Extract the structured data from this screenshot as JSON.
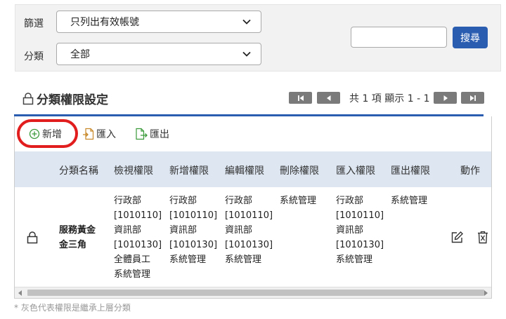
{
  "filters": {
    "screen_label": "篩選",
    "screen_value": "只列出有效帳號",
    "category_label": "分類",
    "category_value": "全部",
    "search_button": "搜尋"
  },
  "section": {
    "title": "分類權限設定",
    "pager_text": "共 1 項 顯示 1 - 1"
  },
  "toolbar": {
    "add_label": "新增",
    "import_label": "匯入",
    "export_label": "匯出"
  },
  "table": {
    "headers": [
      "分類名稱",
      "檢視權限",
      "新增權限",
      "編輯權限",
      "刪除權限",
      "匯入權限",
      "匯出權限",
      "動作"
    ],
    "rows": [
      {
        "name_line1": "服務黃金",
        "name_line2": "金三角",
        "view": [
          "行政部",
          "[1010110]",
          "資訊部",
          "[1010130]",
          "全體員工",
          "系統管理"
        ],
        "add": [
          "行政部",
          "[1010110]",
          "資訊部",
          "[1010130]",
          "系統管理"
        ],
        "edit": [
          "行政部",
          "[1010110]",
          "資訊部",
          "[1010130]",
          "系統管理"
        ],
        "delete": [
          "系統管理"
        ],
        "import": [
          "行政部",
          "[1010110]",
          "資訊部",
          "[1010130]",
          "系統管理"
        ],
        "export": [
          "系統管理"
        ]
      }
    ]
  },
  "footnote": "* 灰色代表權限是繼承上層分類",
  "colors": {
    "accent": "#2a5db0",
    "highlight_ring": "#e21d1d",
    "header_bg": "#dde6f1"
  },
  "icons": [
    "chevron-down-icon",
    "lock-icon",
    "first-page-icon",
    "prev-page-icon",
    "next-page-icon",
    "last-page-icon",
    "add-circle-icon",
    "import-icon",
    "export-icon",
    "edit-icon",
    "delete-icon"
  ]
}
